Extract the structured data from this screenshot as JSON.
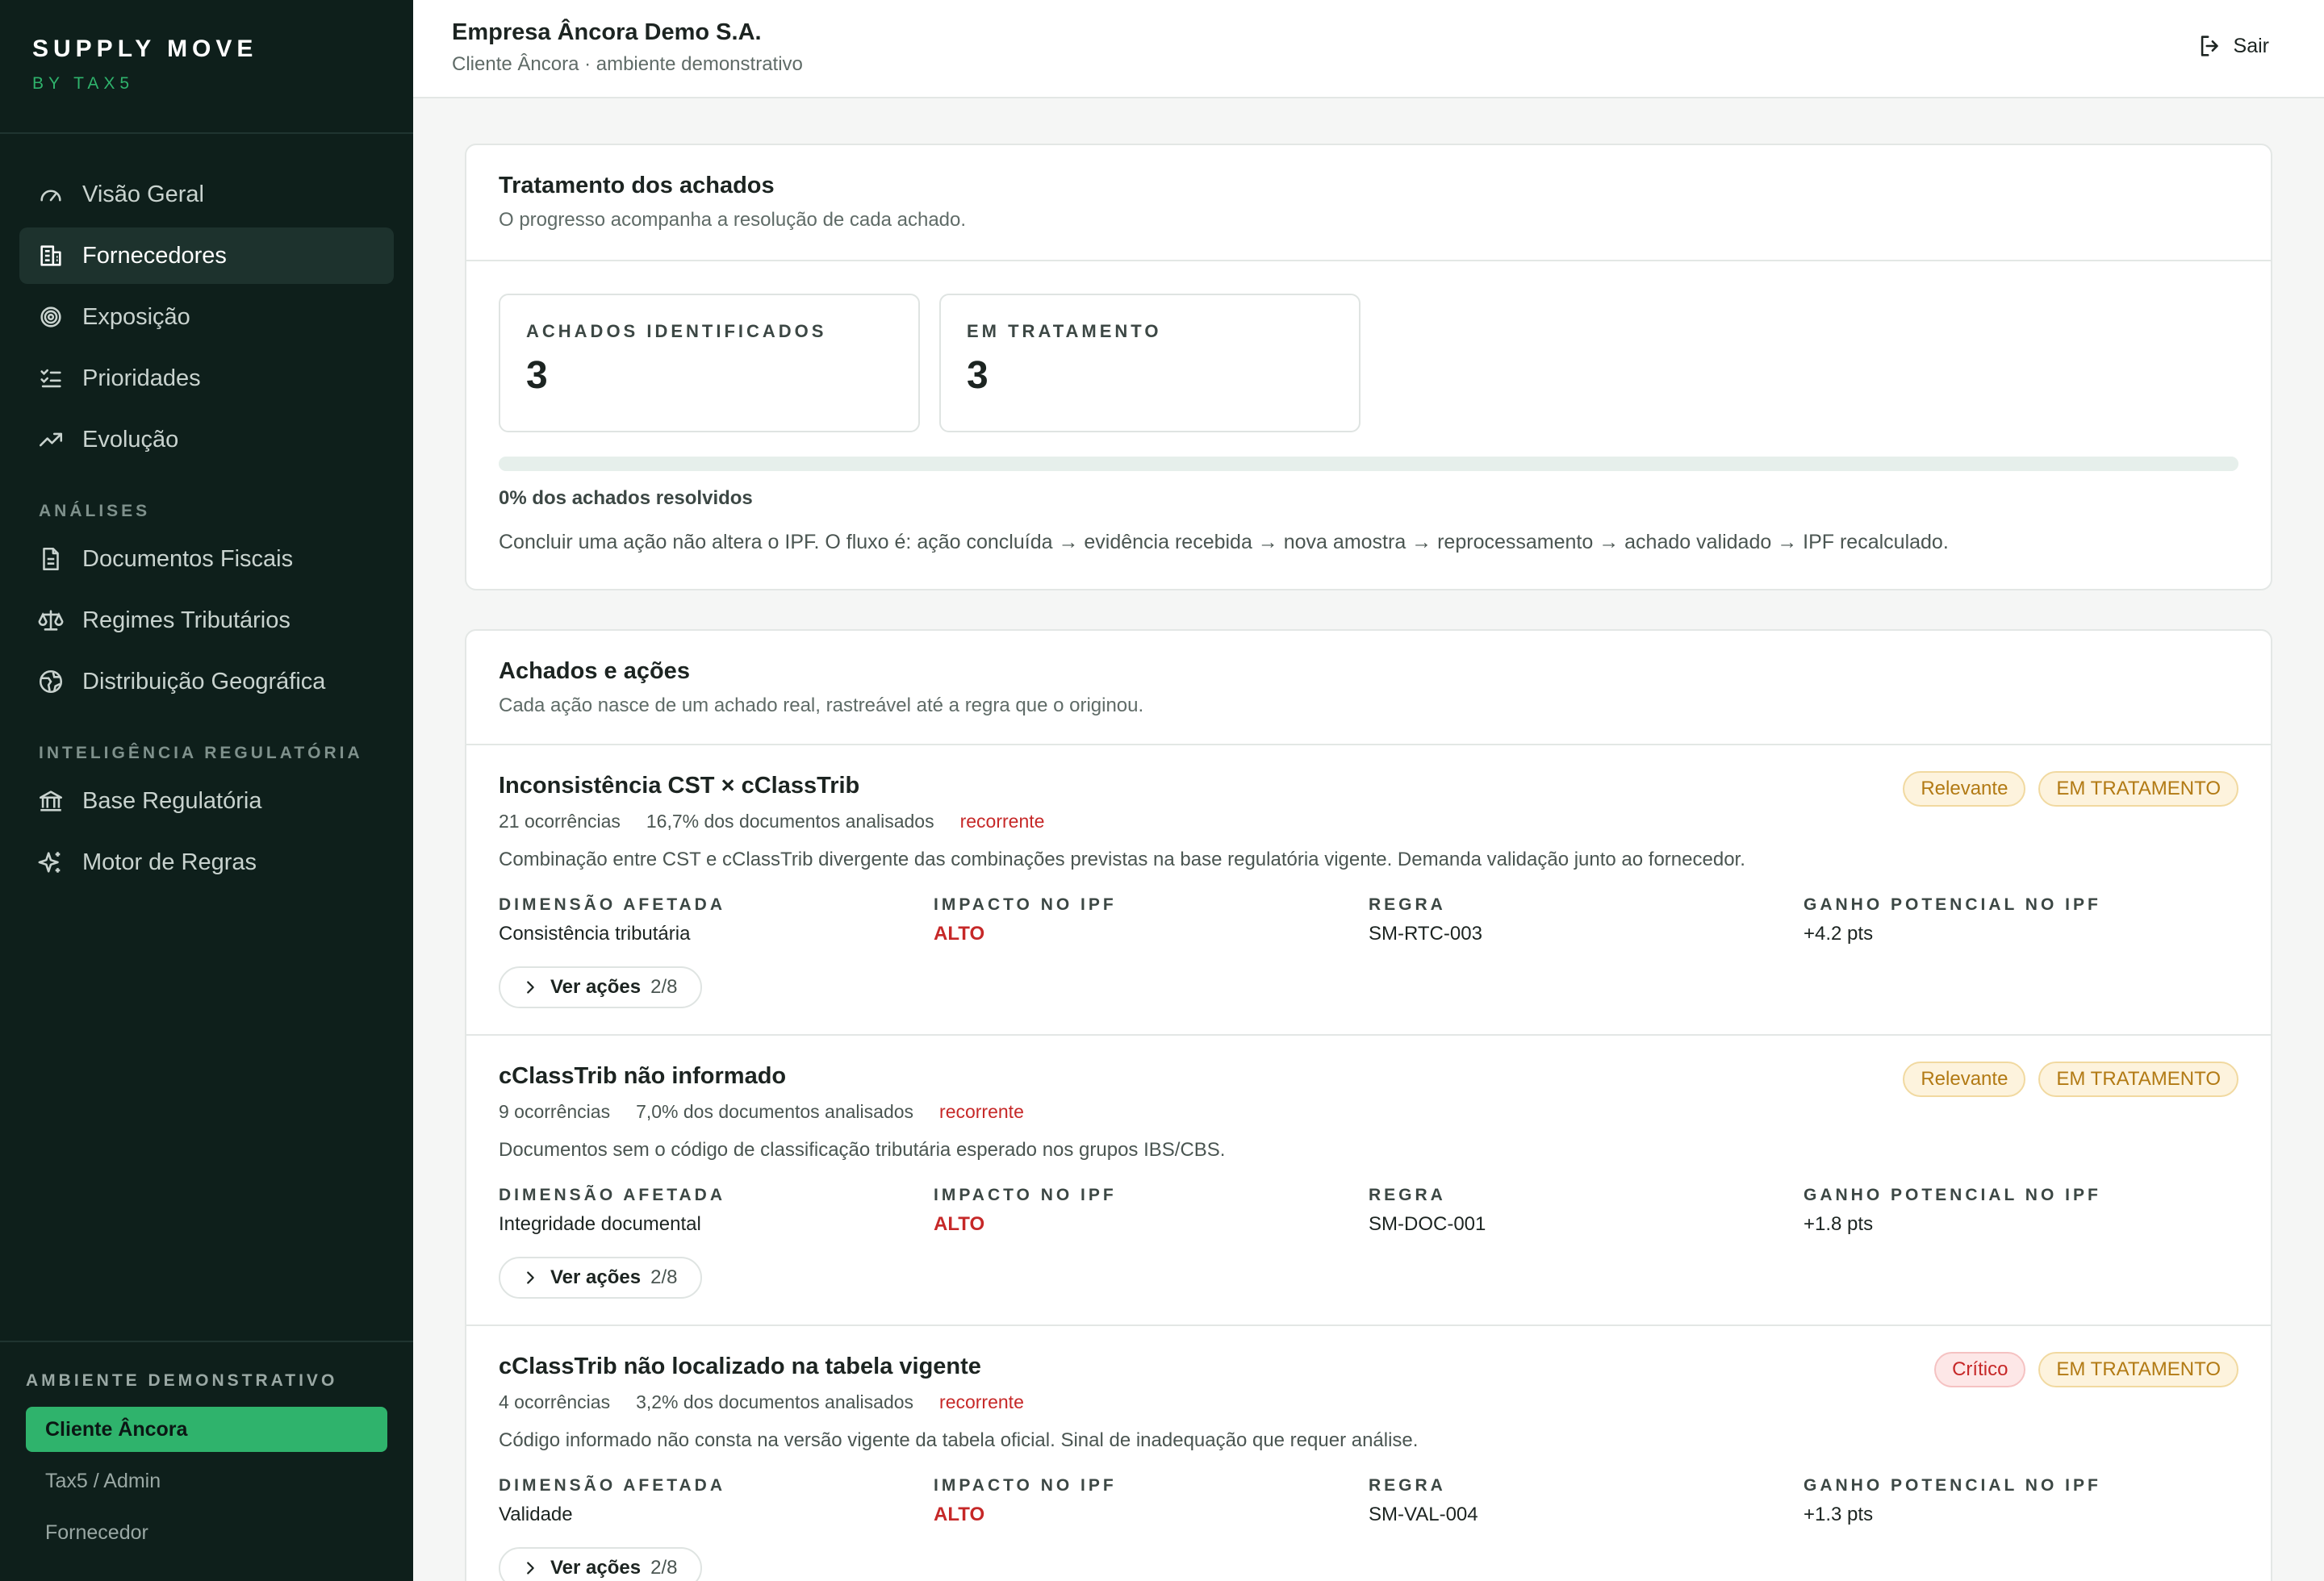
{
  "brand": {
    "title": "SUPPLY MOVE",
    "subtitle": "BY TAX5"
  },
  "nav": {
    "main": [
      {
        "label": "Visão Geral",
        "icon": "gauge-icon"
      },
      {
        "label": "Fornecedores",
        "icon": "building-icon",
        "active": true
      },
      {
        "label": "Exposição",
        "icon": "target-icon"
      },
      {
        "label": "Prioridades",
        "icon": "checklist-icon"
      },
      {
        "label": "Evolução",
        "icon": "trending-up-icon"
      }
    ],
    "analyses_label": "ANÁLISES",
    "analyses": [
      {
        "label": "Documentos Fiscais",
        "icon": "document-icon"
      },
      {
        "label": "Regimes Tributários",
        "icon": "scale-icon"
      },
      {
        "label": "Distribuição Geográfica",
        "icon": "globe-icon"
      }
    ],
    "intel_label": "INTELIGÊNCIA REGULATÓRIA",
    "intel": [
      {
        "label": "Base Regulatória",
        "icon": "institution-icon"
      },
      {
        "label": "Motor de Regras",
        "icon": "sparkles-icon"
      }
    ]
  },
  "environment": {
    "label": "AMBIENTE DEMONSTRATIVO",
    "options": [
      "Cliente Âncora",
      "Tax5 / Admin",
      "Fornecedor"
    ],
    "selected": "Cliente Âncora"
  },
  "header": {
    "company": "Empresa Âncora Demo S.A.",
    "subtitle": "Cliente Âncora · ambiente demonstrativo",
    "logout": "Sair"
  },
  "progress_card": {
    "title": "Tratamento dos achados",
    "subtitle": "O progresso acompanha a resolução de cada achado.",
    "stats": [
      {
        "label": "ACHADOS IDENTIFICADOS",
        "value": "3"
      },
      {
        "label": "EM TRATAMENTO",
        "value": "3"
      }
    ],
    "resolved_fraction": 0,
    "progress_text": "0% dos achados resolvidos",
    "flow_text": "Concluir uma ação não altera o IPF. O fluxo é: ação concluída → evidência recebida → nova amostra → reprocessamento → achado validado → IPF recalculado."
  },
  "findings_card": {
    "title": "Achados e ações",
    "subtitle": "Cada ação nasce de um achado real, rastreável até a regra que o originou.",
    "col_labels": {
      "dimension": "DIMENSÃO AFETADA",
      "impact": "IMPACTO NO IPF",
      "rule": "REGRA",
      "gain": "GANHO POTENCIAL NO IPF"
    },
    "actions_label": "Ver ações",
    "items": [
      {
        "title": "Inconsistência CST × cClassTrib",
        "occurrences": "21 ocorrências",
        "share": "16,7% dos documentos analisados",
        "tag": "recorrente",
        "severity": "Relevante",
        "status": "EM TRATAMENTO",
        "description": "Combinação entre CST e cClassTrib divergente das combinações previstas na base regulatória vigente. Demanda validação junto ao fornecedor.",
        "dimension": "Consistência tributária",
        "impact": "ALTO",
        "rule": "SM-RTC-003",
        "gain": "+4.2 pts",
        "actions_count": "2/8"
      },
      {
        "title": "cClassTrib não informado",
        "occurrences": "9 ocorrências",
        "share": "7,0% dos documentos analisados",
        "tag": "recorrente",
        "severity": "Relevante",
        "status": "EM TRATAMENTO",
        "description": "Documentos sem o código de classificação tributária esperado nos grupos IBS/CBS.",
        "dimension": "Integridade documental",
        "impact": "ALTO",
        "rule": "SM-DOC-001",
        "gain": "+1.8 pts",
        "actions_count": "2/8"
      },
      {
        "title": "cClassTrib não localizado na tabela vigente",
        "occurrences": "4 ocorrências",
        "share": "3,2% dos documentos analisados",
        "tag": "recorrente",
        "severity": "Crítico",
        "status": "EM TRATAMENTO",
        "description": "Código informado não consta na versão vigente da tabela oficial. Sinal de inadequação que requer análise.",
        "dimension": "Validade",
        "impact": "ALTO",
        "rule": "SM-VAL-004",
        "gain": "+1.3 pts",
        "actions_count": "2/8"
      }
    ]
  }
}
